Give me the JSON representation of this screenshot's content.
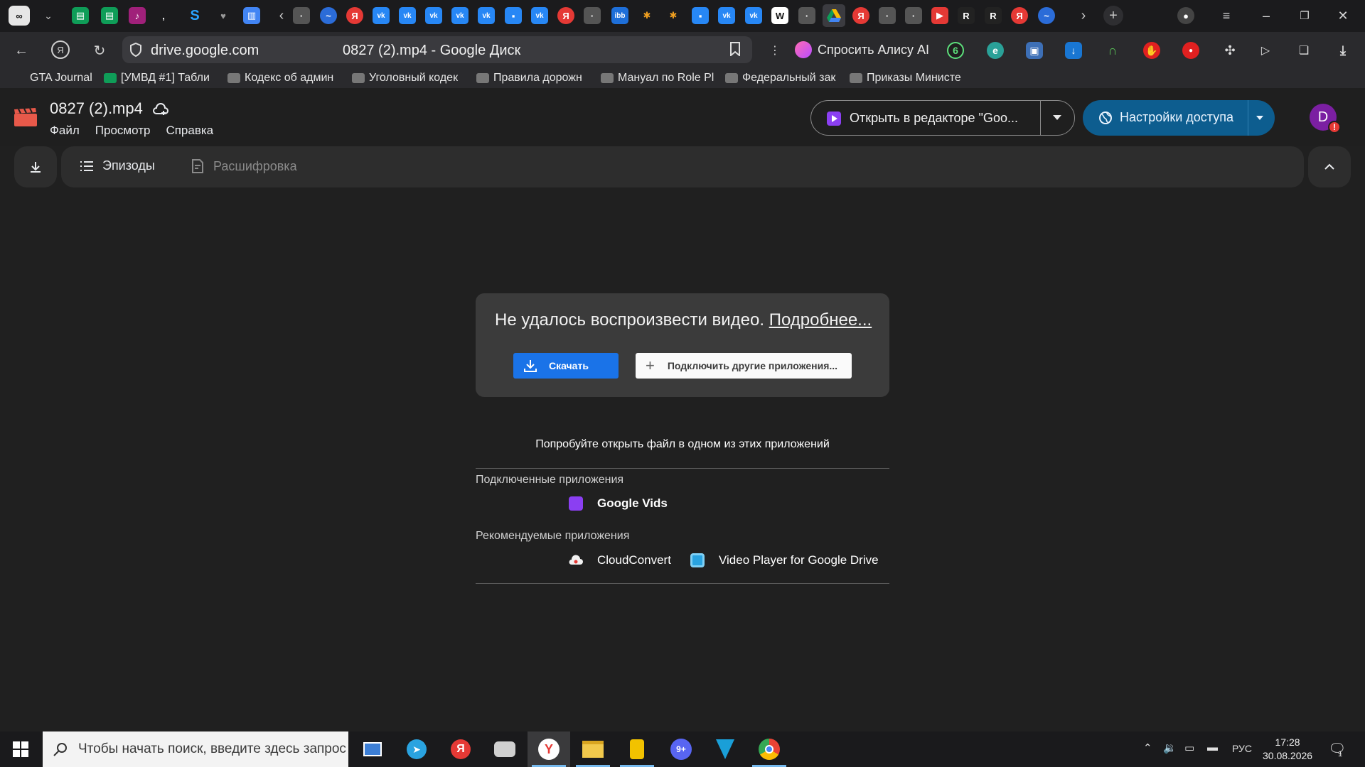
{
  "browser": {
    "url": "drive.google.com",
    "page_title": "0827 (2).mp4 - Google Диск",
    "alice_label": "Спросить Алису AI",
    "bookmarks": [
      "GTA Journal",
      "[УМВД #1] Табли",
      "Кодекс об админ",
      "Уголовный кодек",
      "Правила дорожн",
      "Мануал по Role Pl",
      "Федеральный зак",
      "Приказы Министе"
    ]
  },
  "drive": {
    "file_name": "0827 (2).mp4",
    "menu": [
      "Файл",
      "Просмотр",
      "Справка"
    ],
    "open_in_editor_label": "Открыть в редакторе \"Goo...",
    "share_label": "Настройки доступа",
    "avatar_letter": "D",
    "toolbar": {
      "episodes_label": "Эпизоды",
      "transcript_label": "Расшифровка"
    }
  },
  "error": {
    "message": "Не удалось воспроизвести видео.",
    "more_link": "Подробнее...",
    "download_label": "Скачать",
    "connect_label": "Подключить другие приложения..."
  },
  "apps": {
    "try_open": "Попробуйте открыть файл в одном из этих приложений",
    "connected_title": "Подключенные приложения",
    "connected": [
      "Google Vids"
    ],
    "recommended_title": "Рекомендуемые приложения",
    "recommended": [
      "CloudConvert",
      "Video Player for Google Drive"
    ]
  },
  "taskbar": {
    "search_placeholder": "Чтобы начать поиск, введите здесь запрос",
    "language": "РУС",
    "time": "17:28",
    "date": "30.08.2026",
    "notification_count": "1"
  },
  "colors": {
    "accent_blue": "#1a73e8",
    "share_blue": "#0d5d8f",
    "background": "#202020"
  }
}
